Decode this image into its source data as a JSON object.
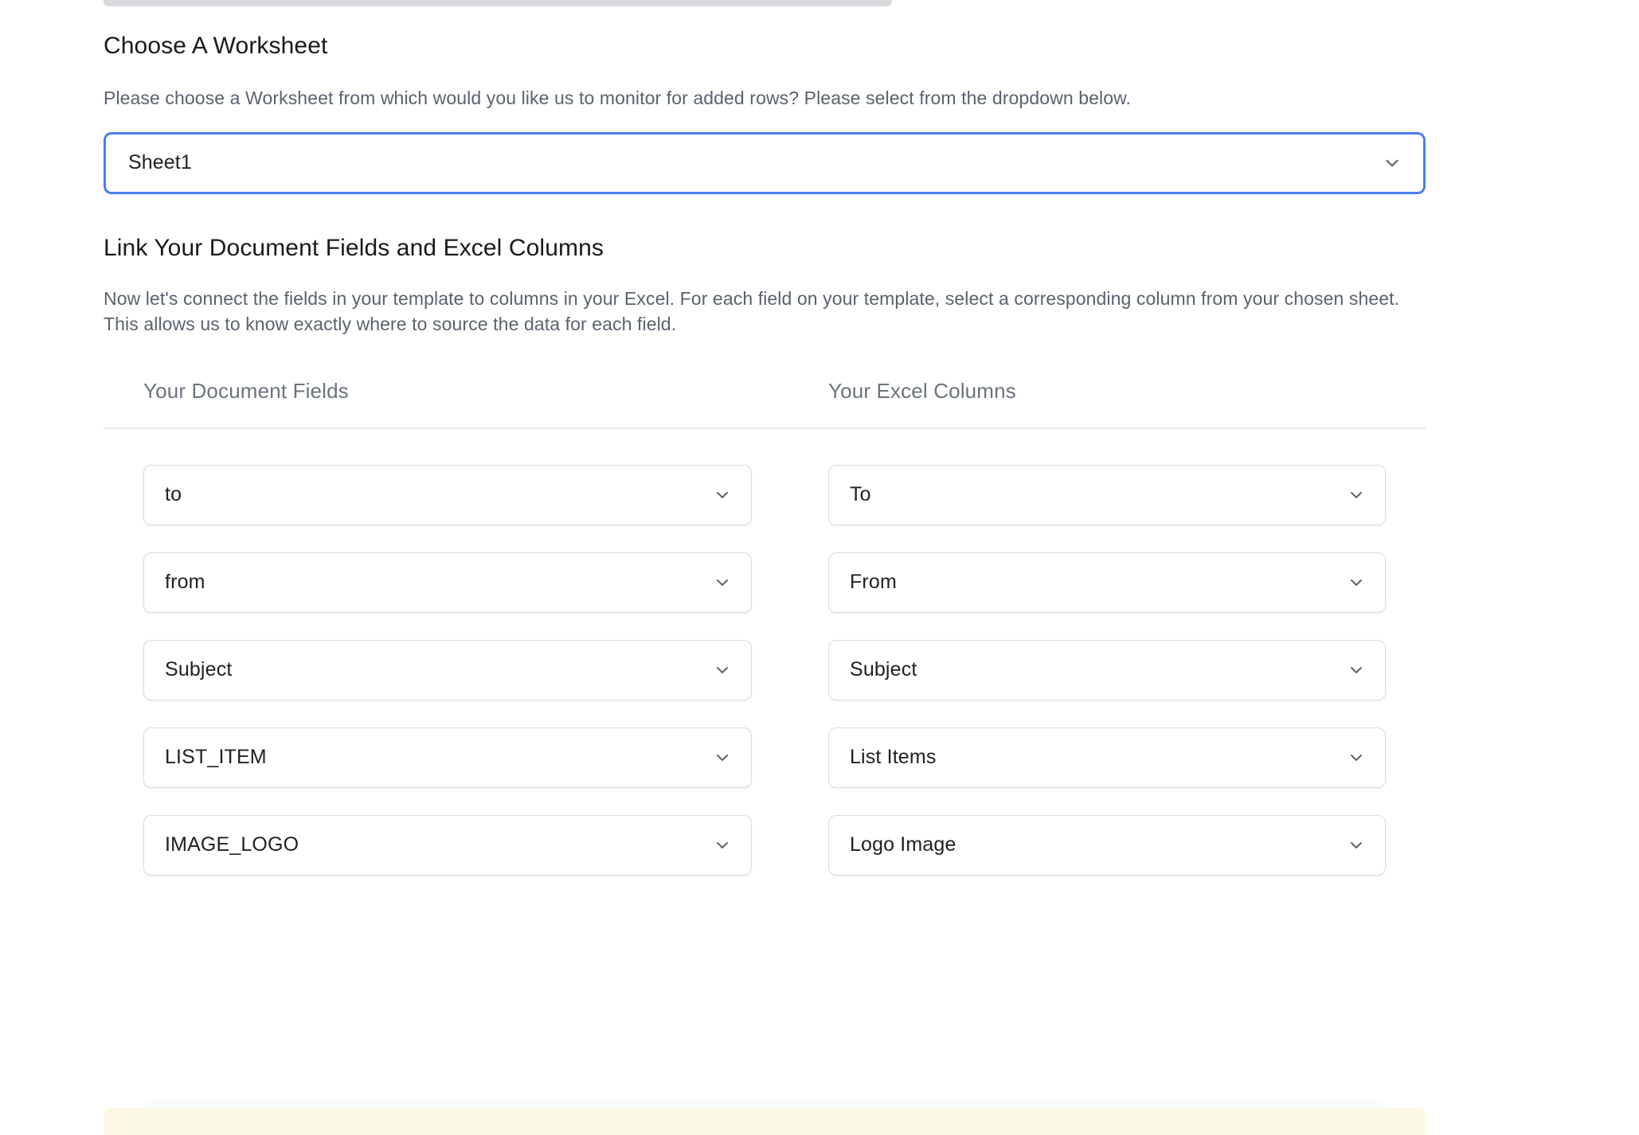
{
  "worksheet_section": {
    "title": "Choose A Worksheet",
    "description": "Please choose a Worksheet from which would you like us to monitor for added rows? Please select from the dropdown below.",
    "selected_value": "Sheet1",
    "chevron_icon": "chevron-down-icon"
  },
  "mapping_section": {
    "title": "Link Your Document Fields and Excel Columns",
    "description": "Now let's connect the fields in your template to columns in your Excel. For each field on your template, select a corresponding column from your chosen sheet. This allows us to know exactly where to source the data for each field.",
    "columns": {
      "document_fields_header": "Your Document Fields",
      "excel_columns_header": "Your Excel Columns"
    },
    "rows": [
      {
        "document_field": "to",
        "excel_column": "To"
      },
      {
        "document_field": "from",
        "excel_column": "From"
      },
      {
        "document_field": "Subject",
        "excel_column": "Subject"
      },
      {
        "document_field": "LIST_ITEM",
        "excel_column": "List Items"
      },
      {
        "document_field": "IMAGE_LOGO",
        "excel_column": "Logo Image"
      }
    ]
  },
  "colors": {
    "focus_border": "#4a7ef0",
    "text_primary": "#202124",
    "text_muted": "#5a6270",
    "header_muted": "#6b7280",
    "field_border": "#dadce0",
    "banner_yellow": "#fbf8e3",
    "top_bar_gray": "#d8dadd"
  }
}
